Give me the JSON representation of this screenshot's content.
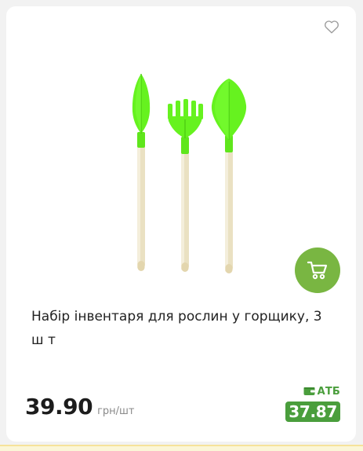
{
  "product": {
    "title": "Набір інвентаря для рослин у горщику, 3 ш т",
    "image_icon": "garden-tools-set-image",
    "price": "39.90",
    "price_unit": "грн/шт",
    "club_brand": "АТБ",
    "club_price": "37.87"
  },
  "icons": {
    "favorite": "heart-icon",
    "cart": "cart-icon",
    "club_card": "wallet-icon"
  },
  "colors": {
    "accent_green": "#79b642",
    "club_green": "#4a9e3c",
    "tool_green": "#66f21f",
    "text": "#222222",
    "muted": "#8a8a8a"
  }
}
